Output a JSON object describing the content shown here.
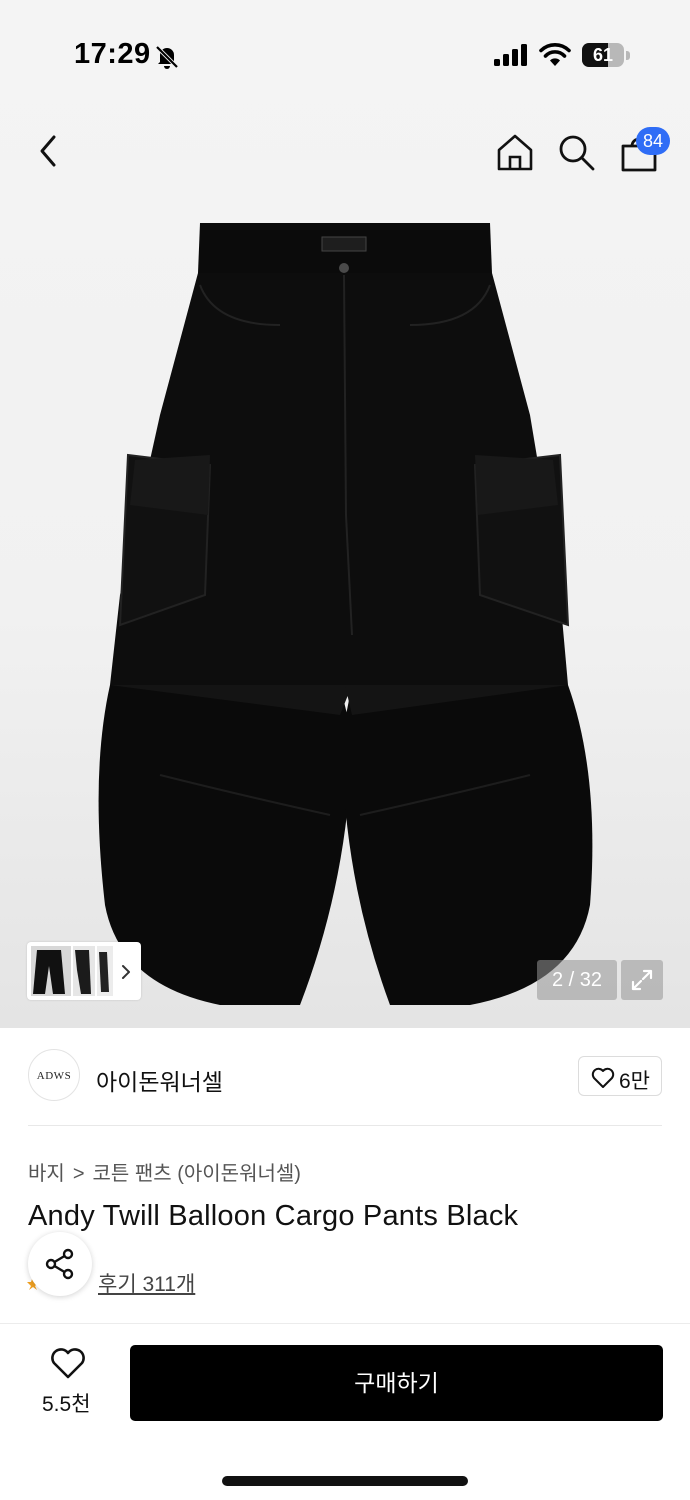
{
  "status_bar": {
    "time": "17:29",
    "battery": "61",
    "battery_level_percent": 61,
    "icons": [
      "bell-slash-icon",
      "cellular-signal-icon",
      "wifi-icon",
      "battery-icon"
    ]
  },
  "nav": {
    "icons": [
      "back-chevron-icon",
      "home-icon",
      "search-icon",
      "shopping-bag-icon"
    ],
    "cart_badge": "84",
    "accent_color": "#2f6df6"
  },
  "gallery": {
    "counter": "2 / 32",
    "current": 2,
    "total": 32,
    "icons": [
      "chevron-right-icon",
      "expand-icon"
    ]
  },
  "brand": {
    "logo_text": "ADWS",
    "name": "아이돈워너셀",
    "like_count": "6만"
  },
  "breadcrumb": {
    "category": "바지",
    "subcategory": "코튼 팬츠 (아이돈워너셀)"
  },
  "product": {
    "title": "Andy Twill Balloon Cargo Pants Black",
    "review_link": "후기 311개"
  },
  "footer": {
    "wish_count": "5.5천",
    "buy_label": "구매하기",
    "buy_button_color": "#000000"
  }
}
